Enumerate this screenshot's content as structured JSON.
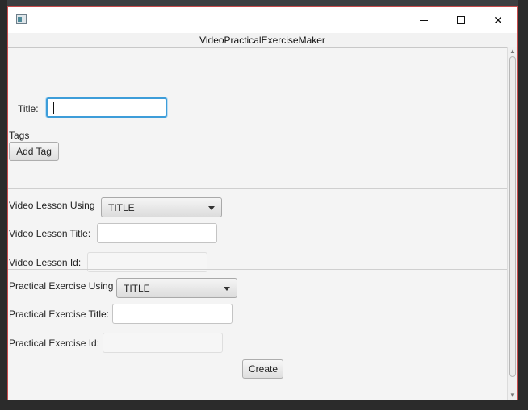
{
  "window": {
    "stage_title": "VideoPracticalExerciseMaker",
    "controls": {
      "minimize_icon": "minimize-icon",
      "maximize_icon": "maximize-icon",
      "close_glyph": "✕"
    }
  },
  "form": {
    "title_label": "Title:",
    "title_value": "",
    "tags_label": "Tags",
    "add_tag_button": "Add Tag",
    "video_lesson": {
      "using_label": "Video Lesson Using",
      "using_selected": "TITLE",
      "title_label": "Video Lesson Title:",
      "title_value": "",
      "id_label": "Video Lesson Id:",
      "id_value": ""
    },
    "practical_exercise": {
      "using_label": "Practical Exercise Using",
      "using_selected": "TITLE",
      "title_label": "Practical Exercise Title:",
      "title_value": "",
      "id_label": "Practical Exercise Id:",
      "id_value": ""
    },
    "create_button": "Create"
  },
  "colors": {
    "focus_ring": "#3d9dd9",
    "window_border": "#c74b4b",
    "background": "#f4f4f4"
  }
}
